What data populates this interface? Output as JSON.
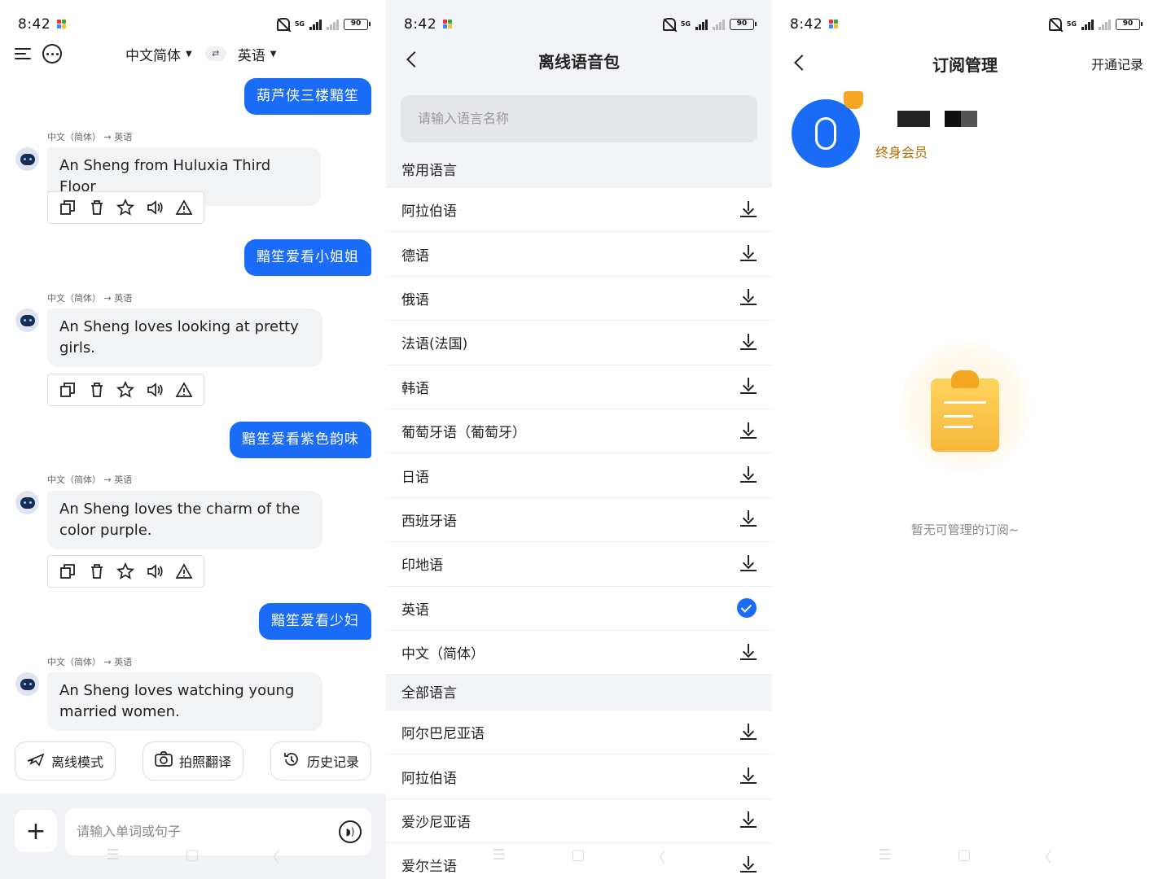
{
  "status": {
    "time": "8:42",
    "battery": "90",
    "network": "5G"
  },
  "translator": {
    "source_lang": "中文简体",
    "target_lang": "英语",
    "direction_label": "中文（简体） → 英语",
    "messages": [
      {
        "user": "葫芦侠三楼黯笙",
        "bot": "An Sheng from Huluxia Third Floor"
      },
      {
        "user": "黯笙爱看小姐姐",
        "bot": "An Sheng loves looking at pretty girls."
      },
      {
        "user": "黯笙爱看紫色韵味",
        "bot": "An Sheng loves the charm of the color purple."
      },
      {
        "user": "黯笙爱看少妇",
        "bot": "An Sheng loves watching young married women."
      }
    ],
    "tools": {
      "offline": "离线模式",
      "photo": "拍照翻译",
      "history": "历史记录"
    },
    "input_placeholder": "请输入单词或句子"
  },
  "offline": {
    "title": "离线语音包",
    "search_placeholder": "请输入语言名称",
    "common_title": "常用语言",
    "common": [
      {
        "name": "阿拉伯语",
        "state": "download"
      },
      {
        "name": "德语",
        "state": "download"
      },
      {
        "name": "俄语",
        "state": "download"
      },
      {
        "name": "法语(法国)",
        "state": "download"
      },
      {
        "name": "韩语",
        "state": "download"
      },
      {
        "name": "葡萄牙语（葡萄牙）",
        "state": "download"
      },
      {
        "name": "日语",
        "state": "download"
      },
      {
        "name": "西班牙语",
        "state": "download"
      },
      {
        "name": "印地语",
        "state": "download"
      },
      {
        "name": "英语",
        "state": "downloaded"
      },
      {
        "name": "中文（简体）",
        "state": "download"
      }
    ],
    "all_title": "全部语言",
    "all": [
      {
        "name": "阿尔巴尼亚语",
        "state": "download"
      },
      {
        "name": "阿拉伯语",
        "state": "download"
      },
      {
        "name": "爱沙尼亚语",
        "state": "download"
      },
      {
        "name": "爱尔兰语",
        "state": "download"
      }
    ]
  },
  "subscription": {
    "title": "订阅管理",
    "record_link": "开通记录",
    "member_label": "终身会员",
    "empty_text": "暂无可管理的订阅~"
  },
  "colors": {
    "accent": "#1a6cf6",
    "gold": "#f5a623",
    "member_text": "#b36a00"
  }
}
